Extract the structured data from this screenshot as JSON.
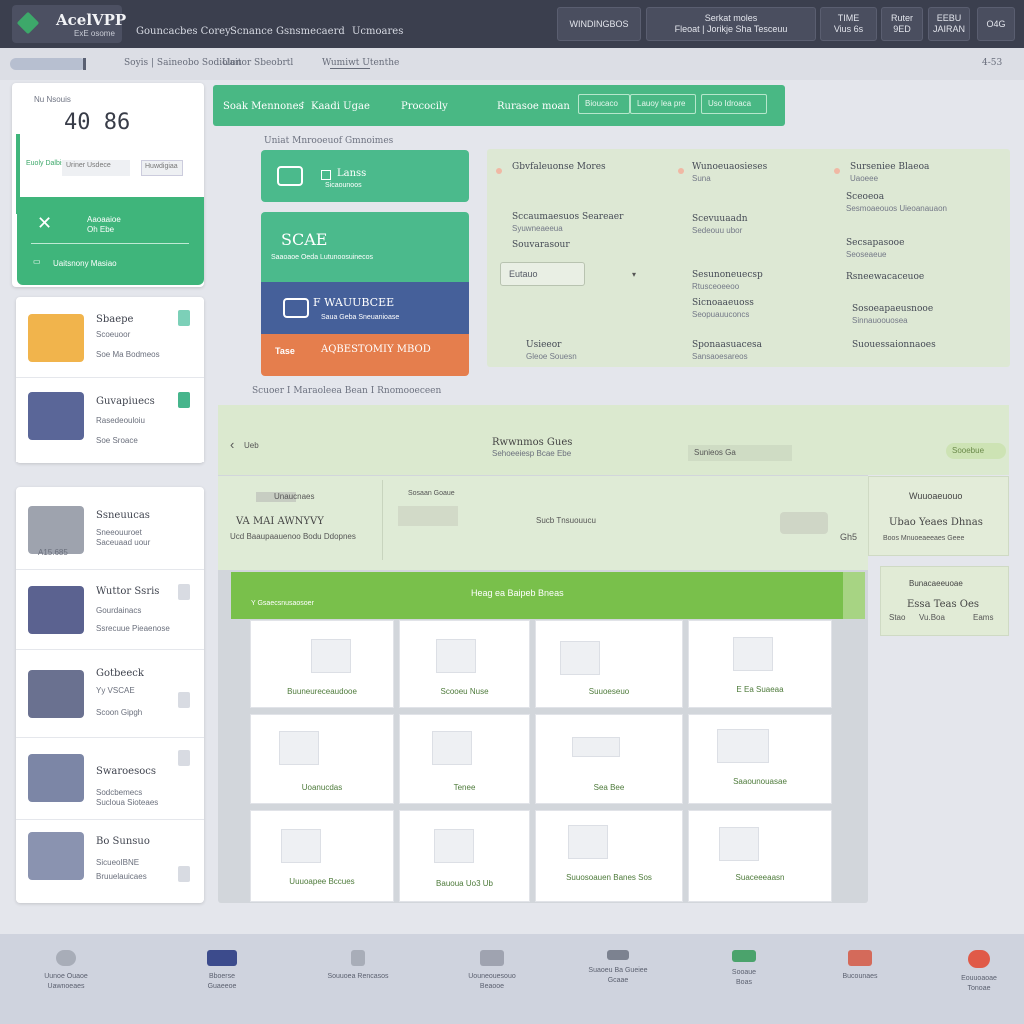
{
  "app": {
    "name": "AcelVPP",
    "subtitle": "ExE osome"
  },
  "topnav": [
    "Gouncacbes Corey",
    "Scnance Gsnsmecaerd",
    "Ucmoares"
  ],
  "top_buttons": [
    {
      "line1": "WINDINGBOS",
      "line2": ""
    },
    {
      "line1": "Serkat moles",
      "line2": "Fleoat | Jorikje Sha Tesceuu"
    },
    {
      "line1": "TIME",
      "line2": "Vius 6s"
    },
    {
      "line1": "Ruter",
      "line2": "9ED"
    },
    {
      "line1": "EEBU",
      "line2": "JAIRAN"
    },
    {
      "line1": "O4G",
      "line2": ""
    }
  ],
  "breadcrumb": [
    "Soyis | Saineobo Sodiolon",
    "Uaitor Sbeobrtl",
    "Wumiwt Utenthe"
  ],
  "breadcrumb_right": "4-53",
  "stat_card": {
    "label": "Nu Nsouis",
    "value": "40 86",
    "chip": "Euoly Dalbiseo",
    "mini": "Uriner Usdece",
    "mini2": "Huwdigiaa",
    "green_title": "Aaoaaioe",
    "green_sub": "Oh Ebe",
    "green_footer": "Uaitsnony Masiao"
  },
  "left_list_a": [
    {
      "title": "Sbaepe",
      "sub1": "Scoeuoor",
      "sub2": "Soe Ma Bodmeos"
    },
    {
      "title": "Guvapiuecs",
      "sub1": "Rasedeouloiu",
      "sub2": "Soe Sroace"
    }
  ],
  "left_list_b": [
    {
      "title": "Ssneuucas",
      "sub1": "Sneeouuroet",
      "sub2": "Saceuaad uour",
      "price": "A15.685"
    },
    {
      "title": "Wuttor Ssris",
      "sub1": "Gourdainacs",
      "sub2": "Ssrecuue Pieaenose"
    },
    {
      "title": "Gotbeeck",
      "sub1": "Yy VSCAE",
      "sub2": "Scoon Gipgh"
    },
    {
      "title": "Swaroesocs",
      "sub1": "Sodcbemecs",
      "sub2": "Sucloua Sioteaes"
    },
    {
      "title": "Bo Sunsuo",
      "sub1": "SicueoIBNE",
      "sub2": "Bruuelauicaes"
    }
  ],
  "greenbar": {
    "items": [
      "Soak Mennones",
      "Kaadi Ugae",
      "Prococily",
      "Rurasoe moan"
    ],
    "input1": "Bioucaco",
    "input2": "Lauoy lea pre",
    "input3": "Uso Idroaca"
  },
  "section_top": "Uniat Mnrooeuof Gmnoimes",
  "section_mid": "Scuoer I Maraoleea Bean I Rnomooeceen",
  "tiles": [
    {
      "title": "Lanss",
      "sub": "Sicaounoos",
      "color": "#4bba8c"
    },
    {
      "title": "SCAE",
      "sub": "Saaoaoe Oeda Lutunoosuinecos",
      "color": "#4bba8c"
    },
    {
      "title": "F WAUUBCEE",
      "sub": "Saua Geba Sneuanioase",
      "color": "#45609a"
    },
    {
      "title": "AQBESTOMIY MBOD",
      "sub": "Tase",
      "color": "#e57e4d"
    }
  ],
  "infogrid": {
    "col1": [
      {
        "h": "Gbvfaleuonse Mores",
        "s": ""
      },
      {
        "h": "Sccaumaesuos Seareaer",
        "s": "Syuwneaeeua"
      },
      {
        "h": "Souvarasour",
        "s": ""
      },
      {
        "h": "Usieeor",
        "s": "Gleoe Souesn"
      }
    ],
    "col2": [
      {
        "h": "Wunoeuaosieses",
        "s": "Suna"
      },
      {
        "h": "Scevuuaadn",
        "s": "Sedeouu ubor"
      },
      {
        "h": "Sesunoneuecsp",
        "s": "Rtusceoeeoo"
      },
      {
        "h": "Sicnoaaeuoss",
        "s": "Seopuauuconcs"
      },
      {
        "h": "Sponaasuacesa",
        "s": "Sansaoesareos"
      }
    ],
    "col3": [
      {
        "h": "Surseniee Blaeoa",
        "s": "Uaoeee"
      },
      {
        "h": "Sceoeoa",
        "s": "Sesmoaeouos Uieoanauaon"
      },
      {
        "h": "Secsapasooe",
        "s": "Seoseaeue"
      },
      {
        "h": "Rsneewacaceuoe",
        "s": ""
      },
      {
        "h": "Sosoeapaeusnooe",
        "s": "Sinnauoouosea"
      },
      {
        "h": "Suouessaionnaoes",
        "s": ""
      }
    ],
    "select": "Eutauo"
  },
  "main": {
    "back": "Ueb",
    "title": "Rwwnmos Gues",
    "subtitle": "Sehoeeiesp Bcae Ebe",
    "center_tag": "Sunieos Ga",
    "right_tag": "Sooebue",
    "detail_label": "Unaucnaes",
    "detail_value": "VA MAI AWNYVY",
    "detail_sub": "Ucd Baaupaauenoo Bodu Ddopnes",
    "col2_label": "Sosaan Goaue",
    "col2_value": "Sucb Tnsuouucu",
    "col2_num": "Gh5",
    "side_label": "Wuuoaeuouo",
    "side_value": "Ubao Yeaes Dhnas",
    "side_sub": "Boos Mnuoeaeeaes Geee",
    "side2_label": "Bunacaeeuoae",
    "side2_value": "Essa Teas Oes",
    "side2_sub1": "Stao",
    "side2_sub2": "Vu.Boa",
    "side2_sub3": "Eams",
    "bar_left": "Y Gsaecsnusaosoer",
    "bar_center": "Heag ea Baipeb Bneas",
    "grid": [
      "Buuneureceaudooe",
      "Scooeu Nuse",
      "Suuoeseuo",
      "E Ea Suaeaa",
      "Uoanucdas",
      "Tenee",
      "Sea Bee",
      "Saaounouasae",
      "Uuuoapee Bccues",
      "Bauoua Uo3 Ub",
      "Suuosoauen Banes Sos",
      "Suaceeeaasn"
    ]
  },
  "dock": [
    {
      "l1": "Uunoe Ouaoe",
      "l2": "Uawnoeaes",
      "color": "#a8adb8"
    },
    {
      "l1": "Bboerse",
      "l2": "Guaeeoe",
      "color": "#3c4b8c"
    },
    {
      "l1": "Souuoea Rencasos",
      "l2": "",
      "color": "#a8adb8"
    },
    {
      "l1": "Uouneouesouo",
      "l2": "Beaooe",
      "color": "#9fa3b0"
    },
    {
      "l1": "Suaoeu Ba Gueiee",
      "l2": "Gcaae",
      "color": "#7c8290"
    },
    {
      "l1": "Sooaue",
      "l2": "Boas",
      "color": "#4ba36c"
    },
    {
      "l1": "Bucounaes",
      "l2": "",
      "color": "#d46a5a"
    },
    {
      "l1": "Eouuoaoae",
      "l2": "Tonoae",
      "color": "#e05a48"
    }
  ]
}
